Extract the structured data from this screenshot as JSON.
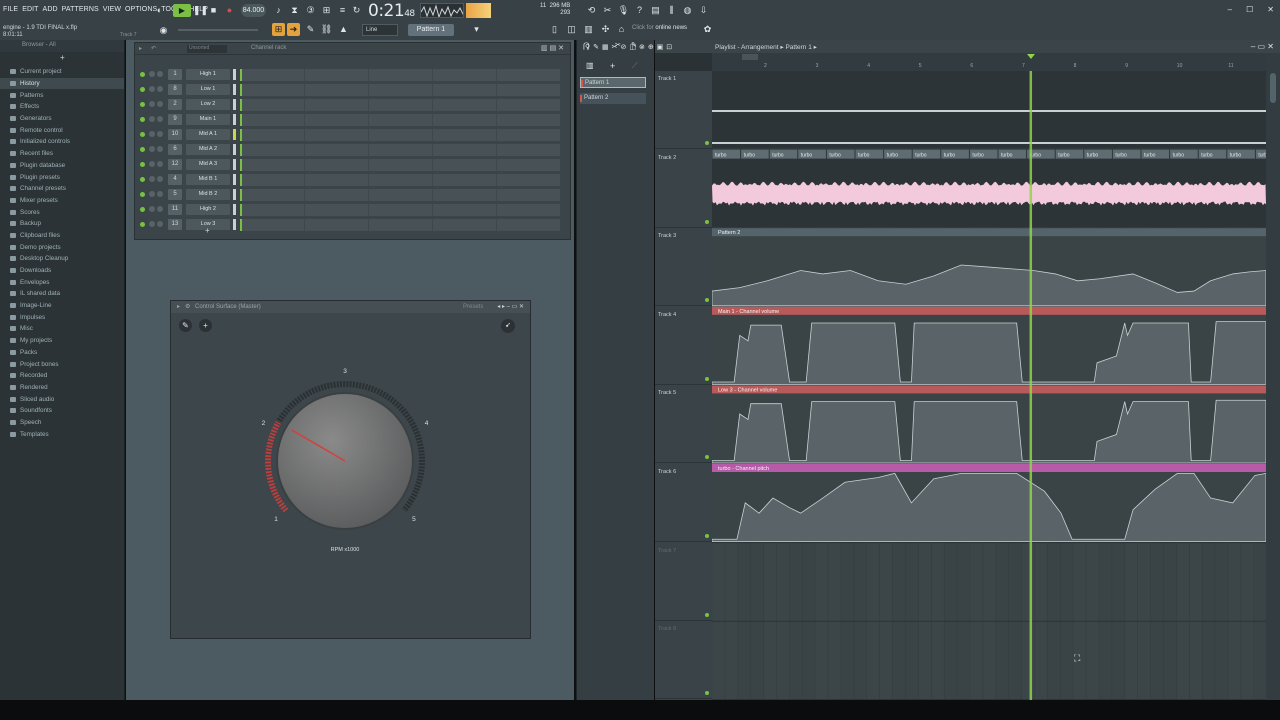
{
  "menu": [
    "FILE",
    "EDIT",
    "ADD",
    "PATTERNS",
    "VIEW",
    "OPTIONS",
    "TOOLS",
    "HELP"
  ],
  "project": {
    "filename": "engine - 1.9 TDI FINAL x.flp",
    "position": "8:01:11",
    "track_hint": "Track 7"
  },
  "transport": {
    "bpm": "84.000",
    "time_main": "0:21",
    "time_sub": "48",
    "cpu_mb": "296 MB",
    "cpu_val1": "11",
    "cpu_val2": "293",
    "line_mode": "Line",
    "pattern": "Pattern 1"
  },
  "news": {
    "click_for": "Click for",
    "label": "online news"
  },
  "window_controls": [
    "–",
    "☐",
    "✕"
  ],
  "browser": {
    "header": "Browser - All",
    "items": [
      {
        "label": "Current project",
        "level": "top",
        "hi": false
      },
      {
        "label": "History",
        "level": "sub",
        "hi": true
      },
      {
        "label": "Patterns",
        "level": "sub",
        "hi": false
      },
      {
        "label": "Effects",
        "level": "sub",
        "hi": false
      },
      {
        "label": "Generators",
        "level": "sub",
        "hi": false
      },
      {
        "label": "Remote control",
        "level": "sub",
        "hi": false
      },
      {
        "label": "Initialized controls",
        "level": "sub",
        "hi": false
      },
      {
        "label": "Recent files",
        "level": "top",
        "hi": false
      },
      {
        "label": "Plugin database",
        "level": "top",
        "hi": false
      },
      {
        "label": "Plugin presets",
        "level": "top",
        "hi": false
      },
      {
        "label": "Channel presets",
        "level": "top",
        "hi": false
      },
      {
        "label": "Mixer presets",
        "level": "top",
        "hi": false
      },
      {
        "label": "Scores",
        "level": "top",
        "hi": false
      },
      {
        "label": "Backup",
        "level": "top",
        "hi": false
      },
      {
        "label": "Clipboard files",
        "level": "top",
        "hi": false
      },
      {
        "label": "Demo projects",
        "level": "top",
        "hi": false
      },
      {
        "label": "Desktop Cleanup",
        "level": "top",
        "hi": false
      },
      {
        "label": "Downloads",
        "level": "top",
        "hi": false
      },
      {
        "label": "Envelopes",
        "level": "top",
        "hi": false
      },
      {
        "label": "IL shared data",
        "level": "top",
        "hi": false
      },
      {
        "label": "Image-Line",
        "level": "top",
        "hi": false
      },
      {
        "label": "Impulses",
        "level": "top",
        "hi": false
      },
      {
        "label": "Misc",
        "level": "top",
        "hi": false
      },
      {
        "label": "My projects",
        "level": "top",
        "hi": false
      },
      {
        "label": "Packs",
        "level": "top",
        "hi": false
      },
      {
        "label": "Project bones",
        "level": "top",
        "hi": false
      },
      {
        "label": "Recorded",
        "level": "top",
        "hi": false
      },
      {
        "label": "Rendered",
        "level": "top",
        "hi": false
      },
      {
        "label": "Sliced audio",
        "level": "top",
        "hi": false
      },
      {
        "label": "Soundfonts",
        "level": "top",
        "hi": false
      },
      {
        "label": "Speech",
        "level": "top",
        "hi": false
      },
      {
        "label": "Templates",
        "level": "top",
        "hi": false
      }
    ]
  },
  "channel_rack": {
    "title": "Channel rack",
    "filter": "Unsorted",
    "channels": [
      {
        "num": "1",
        "name": "High 1",
        "selected": false
      },
      {
        "num": "8",
        "name": "Low 1",
        "selected": false
      },
      {
        "num": "2",
        "name": "Low 2",
        "selected": false
      },
      {
        "num": "9",
        "name": "Main 1",
        "selected": false
      },
      {
        "num": "10",
        "name": "Mid A 1",
        "selected": true
      },
      {
        "num": "6",
        "name": "Mid A 2",
        "selected": false
      },
      {
        "num": "12",
        "name": "Mid A 3",
        "selected": false
      },
      {
        "num": "4",
        "name": "Mid B 1",
        "selected": false
      },
      {
        "num": "5",
        "name": "Mid B 2",
        "selected": false
      },
      {
        "num": "11",
        "name": "High 2",
        "selected": false
      },
      {
        "num": "13",
        "name": "Low 3",
        "selected": false
      }
    ],
    "add_label": "+"
  },
  "control_surface": {
    "title": "Control Surface (Master)",
    "presets": "Presets",
    "knob": {
      "label": "RPM x1000",
      "ticks": [
        "1",
        "2",
        "3",
        "4",
        "5"
      ],
      "value_fraction": 0.27
    }
  },
  "pattern_list": [
    "Pattern 1",
    "Pattern 2"
  ],
  "playlist": {
    "title": "Playlist - Arrangement",
    "pattern_crumb": "Pattern 1",
    "ruler": [
      "2",
      "3",
      "4",
      "5",
      "6",
      "7",
      "8",
      "9",
      "10",
      "11"
    ],
    "tracks": [
      {
        "name": "Track 1",
        "clip": "",
        "clip_color": "#6b7a80"
      },
      {
        "name": "Track 2",
        "clip": "turbo",
        "clip_color": "#6b7a80"
      },
      {
        "name": "Track 3",
        "clip": "Pattern 2",
        "clip_color": "#55636a"
      },
      {
        "name": "Track 4",
        "clip": "Main 1 - Channel volume",
        "clip_color": "#b85a5a"
      },
      {
        "name": "Track 5",
        "clip": "Low 3 - Channel volume",
        "clip_color": "#b85a5a"
      },
      {
        "name": "Track 6",
        "clip": "turbo - Channel pitch",
        "clip_color": "#b75aa8"
      },
      {
        "name": "Track 7",
        "clip": "",
        "clip_color": ""
      },
      {
        "name": "Track 8",
        "clip": "",
        "clip_color": ""
      }
    ],
    "playhead_fraction": 0.575
  },
  "colors": {
    "accent_green": "#7bc043",
    "playhead": "#8fd44a",
    "turbo_wave": "#f3c9dc",
    "automation_fill": "#5a6468"
  }
}
